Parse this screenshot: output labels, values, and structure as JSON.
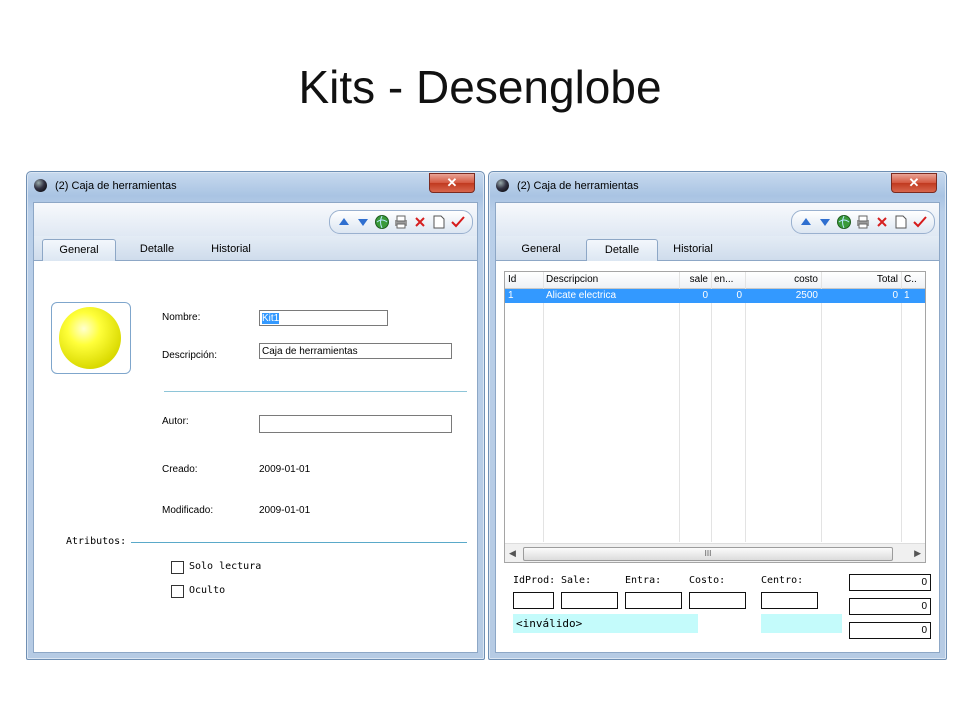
{
  "slide": {
    "title": "Kits - Desenglobe"
  },
  "window_general": {
    "title": "(2) Caja de herramientas",
    "close_label": "✕",
    "tabs": [
      "General",
      "Detalle",
      "Historial"
    ],
    "active_tab": "General",
    "nombre_label": "Nombre:",
    "nombre_value": "Kit1",
    "descripcion_label": "Descripción:",
    "descripcion_value": "Caja de herramientas",
    "autor_label": "Autor:",
    "autor_value": "",
    "creado_label": "Creado:",
    "creado_value": "2009-01-01",
    "modificado_label": "Modificado:",
    "modificado_value": "2009-01-01",
    "atributos_label": "Atributos:",
    "solo_lectura_label": "Solo lectura",
    "oculto_label": "Oculto"
  },
  "window_detalle": {
    "title": "(2) Caja de herramientas",
    "close_label": "✕",
    "tabs": [
      "General",
      "Detalle",
      "Historial"
    ],
    "active_tab": "Detalle",
    "grid": {
      "columns": [
        "Id",
        "Descripcion",
        "sale",
        "en...",
        "costo",
        "Total",
        "C.."
      ],
      "rows": [
        [
          "1",
          "Alicate electrica",
          "0",
          "0",
          "2500",
          "0",
          "1"
        ]
      ],
      "scroll_thumb": "III"
    },
    "form": {
      "idprod_label": "IdProd:",
      "sale_label": "Sale:",
      "entra_label": "Entra:",
      "costo_label": "Costo:",
      "centro_label": "Centro:",
      "invalid_text": "<inválido>",
      "totals": [
        "0",
        "0",
        "0"
      ]
    }
  },
  "toolbar_icons": [
    "arrow-up-icon",
    "arrow-down-icon",
    "globe-refresh-icon",
    "print-icon",
    "delete-icon",
    "new-document-icon",
    "check-icon"
  ],
  "colors": {
    "selected_row": "#3399ff",
    "invalid_bg": "#c4fbfb",
    "close_button": "#c9452b"
  }
}
